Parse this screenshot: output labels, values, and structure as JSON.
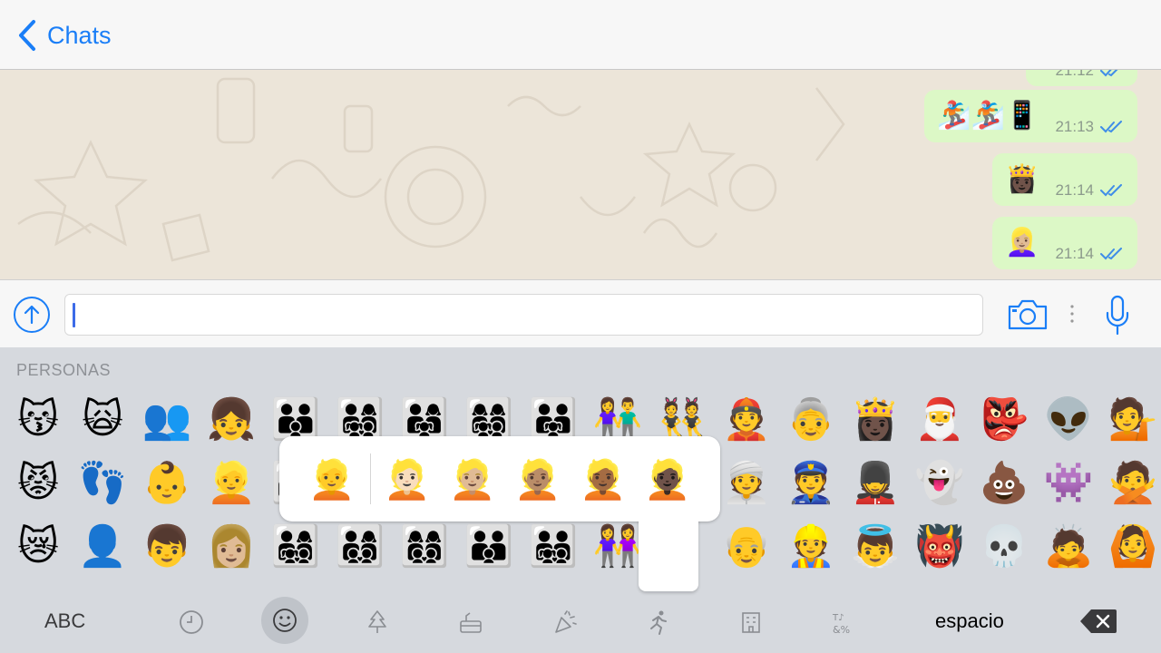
{
  "nav": {
    "back_label": "Chats"
  },
  "messages": [
    {
      "emojis": "",
      "time": "21:12"
    },
    {
      "emojis": "🏂🏂📱",
      "time": "21:13"
    },
    {
      "emojis": "👸🏿",
      "time": "21:14"
    },
    {
      "emojis": "👱🏼‍♀️",
      "time": "21:14"
    }
  ],
  "input": {
    "value": ""
  },
  "keyboard": {
    "section_label": "PERSONAS",
    "rows": [
      [
        "😽",
        "🙀",
        "👥",
        "👧",
        "👪",
        "👨‍👩‍👧‍👦",
        "👨‍👩‍👧",
        "👩‍👩‍👧‍👦",
        "👨‍👨‍👧",
        "👫",
        "👯",
        "👲",
        "👵",
        "👸🏿",
        "🎅",
        "👺",
        "👽",
        "💁"
      ],
      [
        "😾",
        "👣",
        "👶",
        "👱",
        "👨‍👩‍👦",
        "",
        "",
        "",
        "",
        "",
        "",
        "👳",
        "👮",
        "💂",
        "👻",
        "💩",
        "👾",
        "🙅"
      ],
      [
        "😿",
        "👤",
        "👦",
        "👩🏼",
        "👨‍👩‍👧‍👦",
        "👨‍👩‍👦‍👦",
        "👩‍👩‍👦‍👦",
        "👨‍👨‍👦",
        "👨‍👨‍👧‍👦",
        "👭",
        "",
        "👴",
        "👷",
        "👼",
        "👹",
        "💀",
        "🙇",
        "🙆"
      ]
    ],
    "skin_tones": [
      "👱",
      "👱🏻",
      "👱🏼",
      "👱🏽",
      "👱🏾",
      "👱🏿"
    ],
    "abc_label": "ABC",
    "space_label": "espacio",
    "categories": [
      "clock-icon",
      "smiley-icon",
      "tree-icon",
      "cake-icon",
      "party-icon",
      "runner-icon",
      "building-icon",
      "symbols-icon"
    ]
  },
  "colors": {
    "accent": "#1a7ef7",
    "bubble": "#dcf8c6",
    "chat_bg": "#ece5d9",
    "keyboard_bg": "#d6d9de"
  }
}
